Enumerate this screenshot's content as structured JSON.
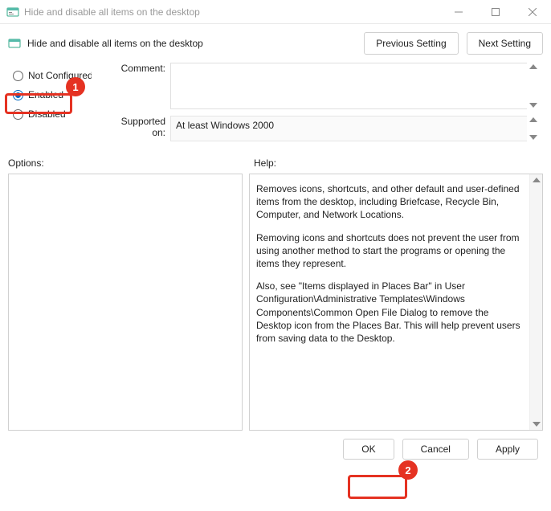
{
  "window": {
    "title": "Hide and disable all items on the desktop"
  },
  "header": {
    "title": "Hide and disable all items on the desktop",
    "prev": "Previous Setting",
    "next": "Next Setting"
  },
  "radio": {
    "not_configured": "Not Configured",
    "enabled": "Enabled",
    "disabled": "Disabled",
    "selected": "enabled"
  },
  "fields": {
    "comment_label": "Comment:",
    "comment_value": "",
    "supported_label": "Supported on:",
    "supported_value": "At least Windows 2000"
  },
  "labels": {
    "options": "Options:",
    "help": "Help:"
  },
  "help": {
    "p1": "Removes icons, shortcuts, and other default and user-defined items from the desktop, including Briefcase, Recycle Bin, Computer, and Network Locations.",
    "p2": "Removing icons and shortcuts does not prevent the user from using another method to start the programs or opening the items they represent.",
    "p3": "Also, see \"Items displayed in Places Bar\" in User Configuration\\Administrative Templates\\Windows Components\\Common Open File Dialog to remove the Desktop icon from the Places Bar. This will help prevent users from saving data to the Desktop."
  },
  "footer": {
    "ok": "OK",
    "cancel": "Cancel",
    "apply": "Apply"
  },
  "annotations": {
    "badge1": "1",
    "badge2": "2"
  }
}
